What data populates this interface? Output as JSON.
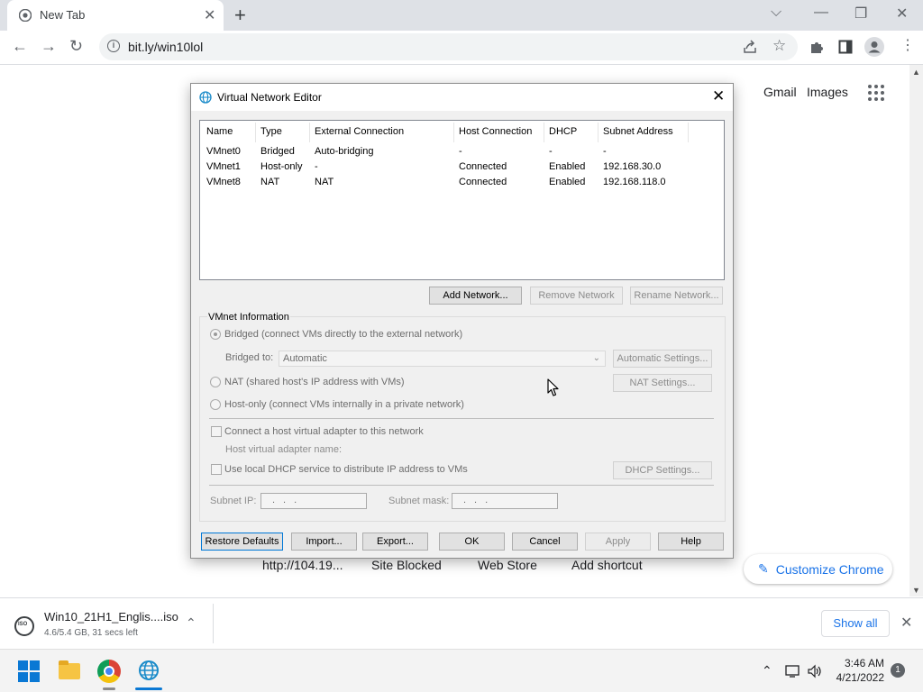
{
  "browser": {
    "tab_title": "New Tab",
    "tab_close": "✕",
    "new_tab": "+",
    "url": "bit.ly/win10lol",
    "min": "—",
    "restore": "❐",
    "close": "✕",
    "chevron": "⌵"
  },
  "page": {
    "gmail": "Gmail",
    "images": "Images",
    "shortcuts": [
      "http://104.19...",
      "Site Blocked",
      "Web Store",
      "Add shortcut"
    ],
    "customize": "Customize Chrome"
  },
  "dialog": {
    "title": "Virtual Network Editor",
    "columns": [
      "Name",
      "Type",
      "External Connection",
      "Host Connection",
      "DHCP",
      "Subnet Address"
    ],
    "rows": [
      [
        "VMnet0",
        "Bridged",
        "Auto-bridging",
        "-",
        "-",
        "-"
      ],
      [
        "VMnet1",
        "Host-only",
        "-",
        "Connected",
        "Enabled",
        "192.168.30.0"
      ],
      [
        "VMnet8",
        "NAT",
        "NAT",
        "Connected",
        "Enabled",
        "192.168.118.0"
      ]
    ],
    "add_network": "Add Network...",
    "remove_network": "Remove Network",
    "rename_network": "Rename Network...",
    "vmnet_info": "VMnet Information",
    "bridged_label": "Bridged (connect VMs directly to the external network)",
    "bridged_to_label": "Bridged to:",
    "bridged_to_value": "Automatic",
    "automatic_settings": "Automatic Settings...",
    "nat_label": "NAT (shared host's IP address with VMs)",
    "nat_settings": "NAT Settings...",
    "hostonly_label": "Host-only (connect VMs internally in a private network)",
    "connect_adapter_label": "Connect a host virtual adapter to this network",
    "adapter_name_label": "Host virtual adapter name:",
    "dhcp_label": "Use local DHCP service to distribute IP address to VMs",
    "dhcp_settings": "DHCP Settings...",
    "subnet_ip_label": "Subnet IP:",
    "subnet_ip_value": "...",
    "subnet_mask_label": "Subnet mask:",
    "subnet_mask_value": "...",
    "restore_defaults": "Restore Defaults",
    "import": "Import...",
    "export": "Export...",
    "ok": "OK",
    "cancel": "Cancel",
    "apply": "Apply",
    "help": "Help",
    "close": "✕"
  },
  "download": {
    "filename": "Win10_21H1_Englis....iso",
    "status": "4.6/5.4 GB, 31 secs left",
    "show_all": "Show all",
    "close": "✕",
    "chevron": "⌃"
  },
  "taskbar": {
    "time": "3:46 AM",
    "date": "4/21/2022",
    "notifications": "1",
    "tray_chevron": "⌃"
  },
  "icons": [
    "chrome-tab-icon",
    "back-icon",
    "forward-icon",
    "reload-icon",
    "info-icon",
    "share-icon",
    "star-icon",
    "extensions-icon",
    "sidepanel-icon",
    "profile-icon",
    "menu-icon",
    "apps-grid-icon",
    "globe-icon",
    "pencil-icon",
    "iso-file-icon",
    "windows-start-icon",
    "file-explorer-icon",
    "chrome-icon",
    "vmware-network-icon",
    "display-icon",
    "volume-icon",
    "mouse-cursor-icon"
  ]
}
